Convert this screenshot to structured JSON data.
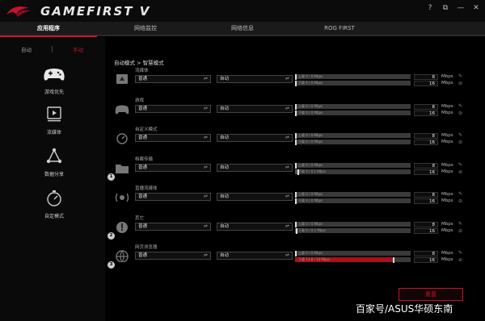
{
  "app": {
    "title": "GAMEFIRST V"
  },
  "window_buttons": [
    "?",
    "⧉",
    "—",
    "✕"
  ],
  "tabs": [
    {
      "label": "应用程序",
      "active": true
    },
    {
      "label": "网络监控",
      "active": false
    },
    {
      "label": "网络信息",
      "active": false
    },
    {
      "label": "ROG FIRST",
      "active": false
    }
  ],
  "mode": {
    "auto": "自动",
    "manual": "手动"
  },
  "sidebar": {
    "items": [
      {
        "label": "游戏优先",
        "icon": "gamepad-icon"
      },
      {
        "label": "流媒体",
        "icon": "play-icon"
      },
      {
        "label": "数据分享",
        "icon": "share-icon"
      },
      {
        "label": "自定模式",
        "icon": "stopwatch-icon"
      }
    ]
  },
  "breadcrumb": "自动模式 > 智慧模式",
  "categories": [
    {
      "label": "流媒体",
      "icon": "media-icon",
      "priority": "普通",
      "speed": "自动",
      "up_text": "上载  0 / 0  Mbps",
      "down_text": "下载  0 / 0  Mbps",
      "up_value": "8",
      "down_value": "16",
      "unit": "Mbps",
      "badge": "",
      "up_fill": 0,
      "down_fill": 0
    },
    {
      "label": "游戏",
      "icon": "gamepad-icon",
      "priority": "普通",
      "speed": "自动",
      "up_text": "上载  0 / 0  Mbps",
      "down_text": "下载  0 / 0  Mbps",
      "up_value": "8",
      "down_value": "16",
      "unit": "Mbps",
      "badge": "",
      "up_fill": 0,
      "down_fill": 0
    },
    {
      "label": "自定义模式",
      "icon": "stopwatch-icon",
      "priority": "普通",
      "speed": "自动",
      "up_text": "上载  0 / 0  Mbps",
      "down_text": "下载  0 / 0  Mbps",
      "up_value": "8",
      "down_value": "16",
      "unit": "Mbps",
      "badge": "",
      "up_fill": 0,
      "down_fill": 0
    },
    {
      "label": "档案传输",
      "icon": "folder-icon",
      "priority": "普通",
      "speed": "自动",
      "up_text": "上载  0 / 0  Mbps",
      "down_text": "下载  0 / 0.1  Mbps",
      "up_value": "8",
      "down_value": "16",
      "unit": "Mbps",
      "badge": "1",
      "up_fill": 0,
      "down_fill": 0.02
    },
    {
      "label": "直播流媒体",
      "icon": "stream-icon",
      "priority": "普通",
      "speed": "自动",
      "up_text": "上载  0 / 0  Mbps",
      "down_text": "下载  0 / 0  Mbps",
      "up_value": "8",
      "down_value": "16",
      "unit": "Mbps",
      "badge": "",
      "up_fill": 0,
      "down_fill": 0
    },
    {
      "label": "其它",
      "icon": "other-icon",
      "priority": "普通",
      "speed": "自动",
      "up_text": "上载  0 / 0  Mbps",
      "down_text": "下载  0 / 0.1  Mbps",
      "up_value": "8",
      "down_value": "16",
      "unit": "Mbps",
      "badge": "2",
      "up_fill": 0,
      "down_fill": 0.01
    },
    {
      "label": "网页浏览器",
      "icon": "browser-icon",
      "priority": "普通",
      "speed": "自动",
      "up_text": "上载  0 / 0  Mbps",
      "down_text": "下载  13.8 / 16  Mbps",
      "up_value": "8",
      "down_value": "16",
      "unit": "Mbps",
      "badge": "3",
      "up_fill": 0,
      "down_fill": 0.86
    }
  ],
  "reset_label": "重置",
  "watermark": "百家号/ASUS华硕东南",
  "colors": {
    "accent": "#c8102e",
    "background": "#0a0a0a"
  }
}
